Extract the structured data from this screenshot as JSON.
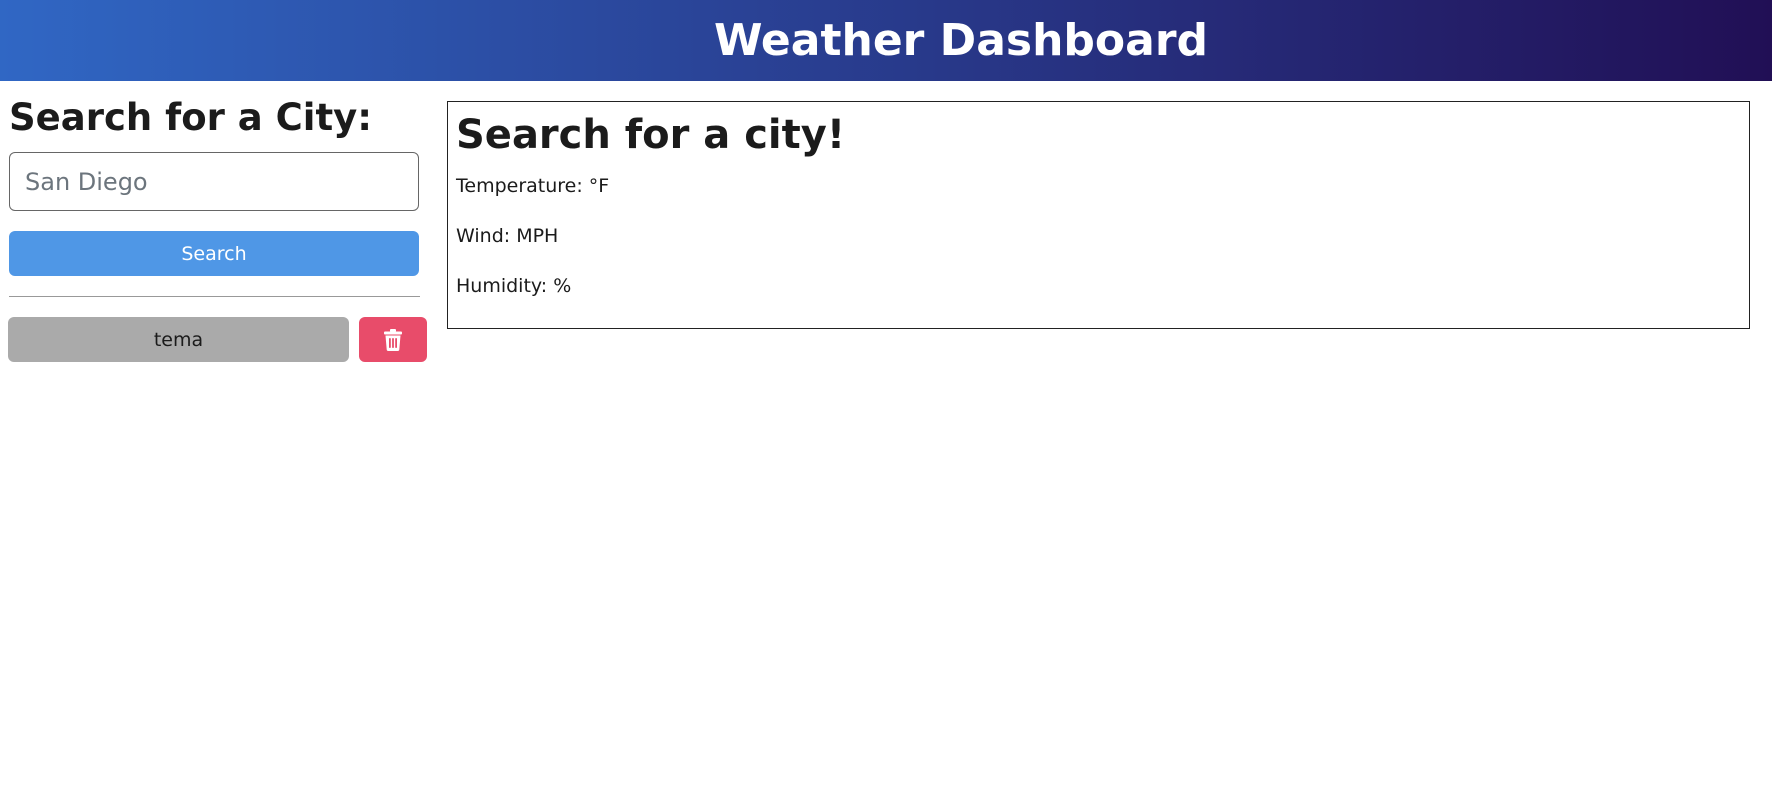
{
  "header": {
    "title": "Weather Dashboard",
    "gradient_start": "#3067c4",
    "gradient_end": "#210f55"
  },
  "sidebar": {
    "heading": "Search for a City:",
    "input_placeholder": "San Diego",
    "input_value": "",
    "search_label": "Search",
    "history": [
      {
        "label": "tema"
      }
    ],
    "delete_icon": "trash-icon"
  },
  "weather": {
    "title": "Search for a city!",
    "temperature": "Temperature: °F",
    "wind": "Wind: MPH",
    "humidity": "Humidity: %"
  },
  "colors": {
    "search_button": "#4f97e6",
    "history_button": "#aaaaaa",
    "delete_button": "#e84c6a"
  }
}
